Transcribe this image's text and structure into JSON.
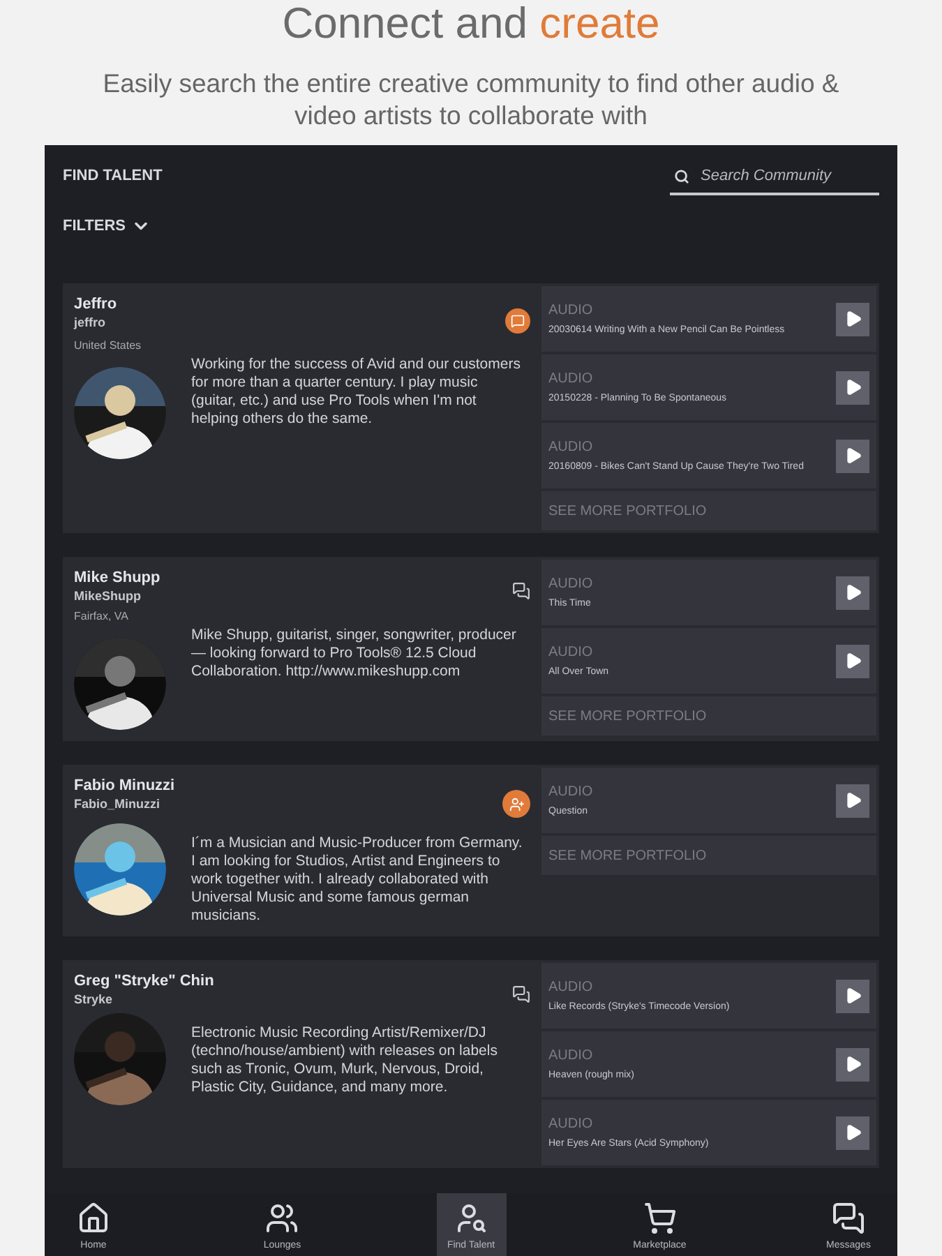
{
  "heading": {
    "text": "Connect and",
    "accent": "create"
  },
  "subtitle": "Easily search the entire creative community to find other audio & video artists to collaborate with",
  "panel": {
    "title": "FIND TALENT",
    "search": {
      "placeholder": "Search Community"
    },
    "filters": "FILTERS"
  },
  "profiles": [
    {
      "name": "Jeffro",
      "handle": "jeffro",
      "location": "United States",
      "kind": "message-highlighted",
      "bio": "Working for the success of Avid and our customers for more than a quarter century. I play music (guitar, etc.) and use Pro Tools when I'm not helping others do the same.",
      "portfolio": [
        {
          "type": "AUDIO",
          "title": "20030614 Writing With a New Pencil Can Be Pointless"
        },
        {
          "type": "AUDIO",
          "title": "20150228 - Planning To Be Spontaneous"
        },
        {
          "type": "AUDIO",
          "title": "20160809 - Bikes Can't Stand Up Cause They're Two Tired"
        }
      ],
      "more": "SEE MORE PORTFOLIO"
    },
    {
      "name": "Mike Shupp",
      "handle": "MikeShupp",
      "location": "Fairfax, VA",
      "kind": "message",
      "bio": "Mike Shupp, guitarist, singer, songwriter, producer — looking forward to Pro Tools® 12.5 Cloud Collaboration. http://www.mikeshupp.com",
      "portfolio": [
        {
          "type": "AUDIO",
          "title": "This Time"
        },
        {
          "type": "AUDIO",
          "title": "All Over Town"
        }
      ],
      "more": "SEE MORE PORTFOLIO"
    },
    {
      "name": "Fabio Minuzzi",
      "handle": "Fabio_Minuzzi",
      "kind": "add-contact",
      "bio": "I´m a Musician and Music-Producer from Germany. I am looking for Studios, Artist and Engineers to work together with. I already collaborated with Universal Music and some famous german musicians.",
      "portfolio": [
        {
          "type": "AUDIO",
          "title": "Question"
        }
      ],
      "more": "SEE MORE PORTFOLIO"
    },
    {
      "name": "Greg \"Stryke\" Chin",
      "handle": "Stryke",
      "kind": "message",
      "bio": "Electronic Music Recording Artist/Remixer/DJ (techno/house/ambient) with releases on labels such as Tronic, Ovum, Murk, Nervous, Droid, Plastic City, Guidance, and many more.",
      "portfolio": [
        {
          "type": "AUDIO",
          "title": "Like Records (Stryke's Timecode Version)"
        },
        {
          "type": "AUDIO",
          "title": "Heaven (rough mix)"
        },
        {
          "type": "AUDIO",
          "title": "Her Eyes Are Stars (Acid Symphony)"
        }
      ]
    }
  ],
  "nav": [
    {
      "label": "Home",
      "selected": false
    },
    {
      "label": "Lounges",
      "selected": false
    },
    {
      "label": "Find Talent",
      "selected": true
    },
    {
      "label": "Marketplace",
      "selected": false
    },
    {
      "label": "Messages",
      "selected": false
    }
  ]
}
